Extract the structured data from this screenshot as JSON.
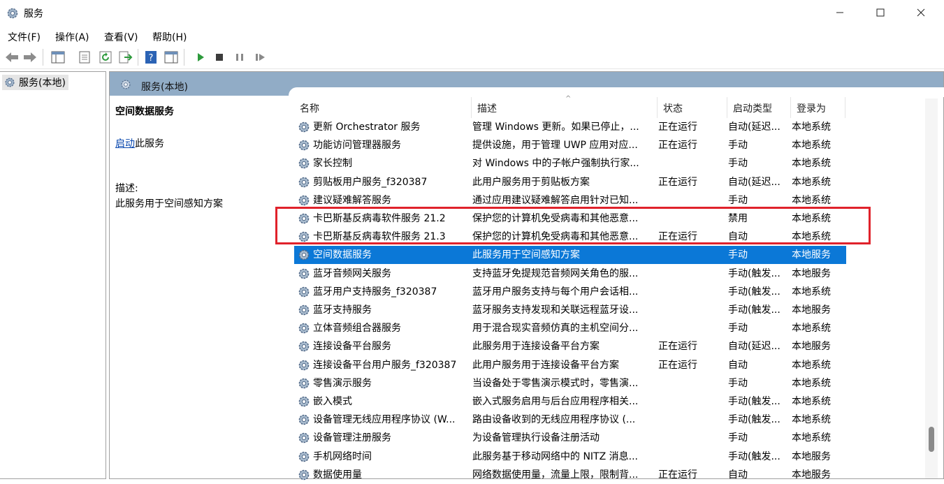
{
  "window": {
    "title": "服务"
  },
  "menu": [
    "文件(F)",
    "操作(A)",
    "查看(V)",
    "帮助(H)"
  ],
  "tree": {
    "item": "服务(本地)"
  },
  "pane": {
    "title": "服务(本地)"
  },
  "detail": {
    "service_name": "空间数据服务",
    "start_link": "启动",
    "start_suffix": "此服务",
    "desc_label": "描述:",
    "desc_text": "此服务用于空间感知方案"
  },
  "columns": [
    "名称",
    "描述",
    "状态",
    "启动类型",
    "登录为"
  ],
  "rows": [
    {
      "name": "更新 Orchestrator 服务",
      "desc": "管理 Windows 更新。如果已停止，...",
      "status": "正在运行",
      "startup": "自动(延迟...",
      "logon": "本地系统"
    },
    {
      "name": "功能访问管理器服务",
      "desc": "提供设施，用于管理 UWP 应用对应...",
      "status": "正在运行",
      "startup": "手动",
      "logon": "本地系统"
    },
    {
      "name": "家长控制",
      "desc": "对 Windows 中的子帐户强制执行家...",
      "status": "",
      "startup": "手动",
      "logon": "本地系统"
    },
    {
      "name": "剪贴板用户服务_f320387",
      "desc": "此用户服务用于剪贴板方案",
      "status": "正在运行",
      "startup": "自动(延迟...",
      "logon": "本地系统"
    },
    {
      "name": "建议疑难解答服务",
      "desc": "通过应用建议疑难解答启用针对已知...",
      "status": "",
      "startup": "手动",
      "logon": "本地系统"
    },
    {
      "name": "卡巴斯基反病毒软件服务 21.2",
      "desc": "保护您的计算机免受病毒和其他恶意...",
      "status": "",
      "startup": "禁用",
      "logon": "本地系统"
    },
    {
      "name": "卡巴斯基反病毒软件服务 21.3",
      "desc": "保护您的计算机免受病毒和其他恶意...",
      "status": "正在运行",
      "startup": "自动",
      "logon": "本地系统"
    },
    {
      "name": "空间数据服务",
      "desc": "此服务用于空间感知方案",
      "status": "",
      "startup": "手动",
      "logon": "本地服务"
    },
    {
      "name": "蓝牙音频网关服务",
      "desc": "支持蓝牙免提规范音频网关角色的服...",
      "status": "",
      "startup": "手动(触发...",
      "logon": "本地服务"
    },
    {
      "name": "蓝牙用户支持服务_f320387",
      "desc": "蓝牙用户服务支持与每个用户会话相...",
      "status": "",
      "startup": "手动(触发...",
      "logon": "本地系统"
    },
    {
      "name": "蓝牙支持服务",
      "desc": "蓝牙服务支持发现和关联远程蓝牙设...",
      "status": "",
      "startup": "手动(触发...",
      "logon": "本地服务"
    },
    {
      "name": "立体音频组合器服务",
      "desc": "用于混合现实音频仿真的主机空间分...",
      "status": "",
      "startup": "手动",
      "logon": "本地系统"
    },
    {
      "name": "连接设备平台服务",
      "desc": "此服务用于连接设备平台方案",
      "status": "正在运行",
      "startup": "自动(延迟...",
      "logon": "本地服务"
    },
    {
      "name": "连接设备平台用户服务_f320387",
      "desc": "此用户服务用于连接设备平台方案",
      "status": "正在运行",
      "startup": "自动",
      "logon": "本地系统"
    },
    {
      "name": "零售演示服务",
      "desc": "当设备处于零售演示模式时，零售演...",
      "status": "",
      "startup": "手动",
      "logon": "本地系统"
    },
    {
      "name": "嵌入模式",
      "desc": "嵌入式服务启用与后台应用程序相关...",
      "status": "",
      "startup": "手动(触发...",
      "logon": "本地系统"
    },
    {
      "name": "设备管理无线应用程序协议 (W...",
      "desc": "路由设备收到的无线应用程序协议 (...",
      "status": "",
      "startup": "手动(触发...",
      "logon": "本地系统"
    },
    {
      "name": "设备管理注册服务",
      "desc": "为设备管理执行设备注册活动",
      "status": "",
      "startup": "手动",
      "logon": "本地系统"
    },
    {
      "name": "手机网络时间",
      "desc": "此服务基于移动网络中的 NITZ 消息...",
      "status": "",
      "startup": "手动(触发...",
      "logon": "本地服务"
    },
    {
      "name": "数据使用量",
      "desc": "网络数据使用量，流量上限，限制背...",
      "status": "正在运行",
      "startup": "自动",
      "logon": "本地服务"
    }
  ],
  "selected_row": 7,
  "highlight_rows": [
    5,
    6
  ],
  "colors": {
    "selection": "#0b78d7",
    "header": "#91acc6",
    "highlight": "#e0222b"
  }
}
